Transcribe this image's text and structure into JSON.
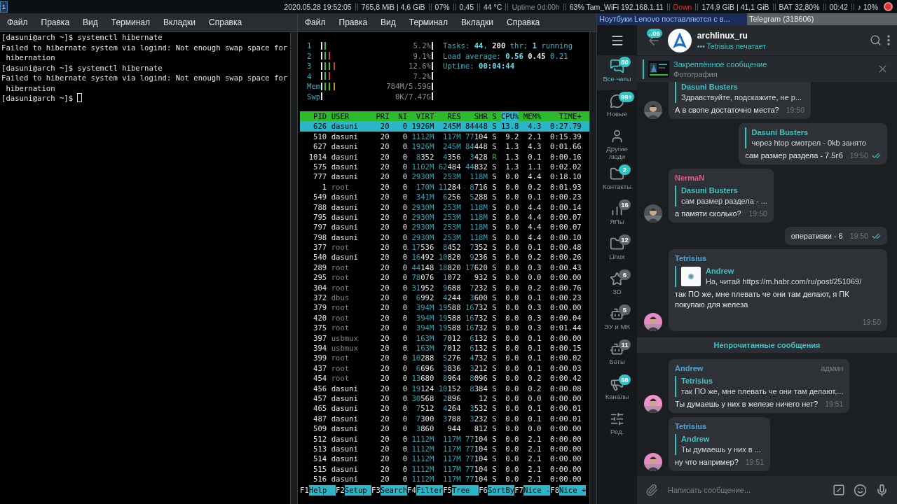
{
  "top_bar": {
    "workspace": "1",
    "segments": [
      {
        "text": "2020.05.28 19:52:05",
        "kind": "normal"
      },
      {
        "text": "765,8 MiB | 4,6 GiB",
        "kind": "normal"
      },
      {
        "text": "07%",
        "kind": "normal"
      },
      {
        "text": "0,45",
        "kind": "normal"
      },
      {
        "text": "44 °C",
        "kind": "normal"
      },
      {
        "text": "Uptime 0d:00h",
        "kind": "dim"
      },
      {
        "text": "63% Tam_WiFi 192.168.1.11",
        "kind": "normal"
      },
      {
        "text": "Down",
        "kind": "alert"
      },
      {
        "text": "174,9 GiB | 41,1 GiB",
        "kind": "normal"
      },
      {
        "text": "BAT 32,80%",
        "kind": "normal"
      },
      {
        "text": "00:42",
        "kind": "normal"
      },
      {
        "text": "♪ 10%",
        "kind": "normal"
      }
    ]
  },
  "terminal": {
    "menu": [
      "Файл",
      "Правка",
      "Вид",
      "Терминал",
      "Вкладки",
      "Справка"
    ],
    "lines": [
      "[dasuni@arch ~]$ systemctl hibernate",
      "Failed to hibernate system via logind: Not enough swap space for",
      " hibernation",
      "[dasuni@arch ~]$ systemctl hibernate",
      "Failed to hibernate system via logind: Not enough swap space for",
      " hibernation"
    ],
    "prompt": "[dasuni@arch ~]$"
  },
  "htop": {
    "menu": [
      "Файл",
      "Правка",
      "Вид",
      "Терминал",
      "Вкладки",
      "Справка"
    ],
    "meters": [
      {
        "kind": "cpu",
        "label": "1",
        "level": 0.052,
        "reading": "5.2%"
      },
      {
        "kind": "cpu",
        "label": "2",
        "level": 0.091,
        "reading": "9.1%"
      },
      {
        "kind": "cpu",
        "label": "3",
        "level": 0.126,
        "reading": "12.6%"
      },
      {
        "kind": "cpu",
        "label": "4",
        "level": 0.072,
        "reading": "7.2%"
      },
      {
        "kind": "mem",
        "label": "Mem",
        "level": 0.14,
        "reading": "784M/5.59G"
      },
      {
        "kind": "swap",
        "label": "Swp",
        "level": 0,
        "reading": "0K/7.47G"
      }
    ],
    "info": [
      "Tasks: **44**, **200** thr; **1** running",
      "Load average: **0.56** **0.45** 0.21",
      "Uptime: **00:04:44**"
    ],
    "columns": [
      {
        "label": "PID",
        "sorted": false
      },
      {
        "label": "USER",
        "sorted": false
      },
      {
        "label": "PRI",
        "sorted": false
      },
      {
        "label": "NI",
        "sorted": false
      },
      {
        "label": "VIRT",
        "sorted": false
      },
      {
        "label": "RES",
        "sorted": false
      },
      {
        "label": "SHR",
        "sorted": false
      },
      {
        "label": "S",
        "sorted": false
      },
      {
        "label": "CPU%",
        "sorted": true
      },
      {
        "label": "MEM%",
        "sorted": false
      },
      {
        "label": "TIME+",
        "sorted": false
      }
    ],
    "rows": [
      {
        "cells": [
          "626",
          "dasuni",
          "20",
          "0",
          "1926M",
          "245M",
          "84448",
          "S",
          "13.8",
          "4.3",
          "0:27.79"
        ],
        "own": true,
        "running": false,
        "selected": true
      },
      {
        "cells": [
          "510",
          "dasuni",
          "20",
          "0",
          "1112M",
          "117M",
          "77104",
          "S",
          "9.2",
          "2.1",
          "0:15.39"
        ],
        "own": true,
        "running": false,
        "selected": false
      },
      {
        "cells": [
          "627",
          "dasuni",
          "20",
          "0",
          "1926M",
          "245M",
          "84448",
          "S",
          "1.3",
          "4.3",
          "0:01.66"
        ],
        "own": true,
        "running": false,
        "selected": false
      },
      {
        "cells": [
          "1014",
          "dasuni",
          "20",
          "0",
          "8352",
          "4356",
          "3428",
          "R",
          "1.3",
          "0.1",
          "0:00.16"
        ],
        "own": true,
        "running": true,
        "selected": false
      },
      {
        "cells": [
          "575",
          "dasuni",
          "20",
          "0",
          "1102M",
          "62484",
          "44832",
          "S",
          "1.3",
          "1.1",
          "0:02.02"
        ],
        "own": true,
        "running": false,
        "selected": false
      },
      {
        "cells": [
          "777",
          "dasuni",
          "20",
          "0",
          "2930M",
          "253M",
          "118M",
          "S",
          "0.0",
          "4.4",
          "0:18.10"
        ],
        "own": true,
        "running": false,
        "selected": false
      },
      {
        "cells": [
          "1",
          "root",
          "20",
          "0",
          "170M",
          "11284",
          "8716",
          "S",
          "0.0",
          "0.2",
          "0:01.93"
        ],
        "own": false,
        "running": false,
        "selected": false
      },
      {
        "cells": [
          "549",
          "dasuni",
          "20",
          "0",
          "341M",
          "6256",
          "5288",
          "S",
          "0.0",
          "0.1",
          "0:00.23"
        ],
        "own": true,
        "running": false,
        "selected": false
      },
      {
        "cells": [
          "788",
          "dasuni",
          "20",
          "0",
          "2930M",
          "253M",
          "118M",
          "S",
          "0.0",
          "4.4",
          "0:00.14"
        ],
        "own": true,
        "running": false,
        "selected": false
      },
      {
        "cells": [
          "795",
          "dasuni",
          "20",
          "0",
          "2930M",
          "253M",
          "118M",
          "S",
          "0.0",
          "4.4",
          "0:00.07"
        ],
        "own": true,
        "running": false,
        "selected": false
      },
      {
        "cells": [
          "797",
          "dasuni",
          "20",
          "0",
          "2930M",
          "253M",
          "118M",
          "S",
          "0.0",
          "4.4",
          "0:00.07"
        ],
        "own": true,
        "running": false,
        "selected": false
      },
      {
        "cells": [
          "798",
          "dasuni",
          "20",
          "0",
          "2930M",
          "253M",
          "118M",
          "S",
          "0.0",
          "4.4",
          "0:00.10"
        ],
        "own": true,
        "running": false,
        "selected": false
      },
      {
        "cells": [
          "377",
          "root",
          "20",
          "0",
          "17536",
          "8452",
          "7352",
          "S",
          "0.0",
          "0.1",
          "0:00.48"
        ],
        "own": false,
        "running": false,
        "selected": false
      },
      {
        "cells": [
          "540",
          "dasuni",
          "20",
          "0",
          "16492",
          "10820",
          "9236",
          "S",
          "0.0",
          "0.2",
          "0:00.26"
        ],
        "own": true,
        "running": false,
        "selected": false
      },
      {
        "cells": [
          "289",
          "root",
          "20",
          "0",
          "44148",
          "18820",
          "17620",
          "S",
          "0.0",
          "0.3",
          "0:00.43"
        ],
        "own": false,
        "running": false,
        "selected": false
      },
      {
        "cells": [
          "295",
          "root",
          "20",
          "0",
          "78076",
          "1072",
          "932",
          "S",
          "0.0",
          "0.0",
          "0:00.00"
        ],
        "own": false,
        "running": false,
        "selected": false
      },
      {
        "cells": [
          "304",
          "root",
          "20",
          "0",
          "31952",
          "9688",
          "7232",
          "S",
          "0.0",
          "0.2",
          "0:00.76"
        ],
        "own": false,
        "running": false,
        "selected": false
      },
      {
        "cells": [
          "372",
          "dbus",
          "20",
          "0",
          "6992",
          "4244",
          "3600",
          "S",
          "0.0",
          "0.1",
          "0:00.23"
        ],
        "own": false,
        "running": false,
        "selected": false
      },
      {
        "cells": [
          "379",
          "root",
          "20",
          "0",
          "394M",
          "19588",
          "16732",
          "S",
          "0.0",
          "0.3",
          "0:00.00"
        ],
        "own": false,
        "running": false,
        "selected": false
      },
      {
        "cells": [
          "420",
          "root",
          "20",
          "0",
          "394M",
          "19588",
          "16732",
          "S",
          "0.0",
          "0.3",
          "0:00.04"
        ],
        "own": false,
        "running": false,
        "selected": false
      },
      {
        "cells": [
          "375",
          "root",
          "20",
          "0",
          "394M",
          "19588",
          "16732",
          "S",
          "0.0",
          "0.3",
          "0:01.44"
        ],
        "own": false,
        "running": false,
        "selected": false
      },
      {
        "cells": [
          "397",
          "usbmux",
          "20",
          "0",
          "163M",
          "7012",
          "6132",
          "S",
          "0.0",
          "0.1",
          "0:00.00"
        ],
        "own": false,
        "running": false,
        "selected": false
      },
      {
        "cells": [
          "394",
          "usbmux",
          "20",
          "0",
          "163M",
          "7012",
          "6132",
          "S",
          "0.0",
          "0.1",
          "0:00.15"
        ],
        "own": false,
        "running": false,
        "selected": false
      },
      {
        "cells": [
          "399",
          "root",
          "20",
          "0",
          "10288",
          "5276",
          "4732",
          "S",
          "0.0",
          "0.1",
          "0:00.02"
        ],
        "own": false,
        "running": false,
        "selected": false
      },
      {
        "cells": [
          "437",
          "root",
          "20",
          "0",
          "6696",
          "3836",
          "3212",
          "S",
          "0.0",
          "0.1",
          "0:00.03"
        ],
        "own": false,
        "running": false,
        "selected": false
      },
      {
        "cells": [
          "454",
          "root",
          "20",
          "0",
          "13680",
          "8964",
          "8096",
          "S",
          "0.0",
          "0.2",
          "0:00.42"
        ],
        "own": false,
        "running": false,
        "selected": false
      },
      {
        "cells": [
          "456",
          "dasuni",
          "20",
          "0",
          "19124",
          "10152",
          "8384",
          "S",
          "0.0",
          "0.2",
          "0:00.08"
        ],
        "own": true,
        "running": false,
        "selected": false
      },
      {
        "cells": [
          "457",
          "dasuni",
          "20",
          "0",
          "30568",
          "2896",
          "12",
          "S",
          "0.0",
          "0.0",
          "0:00.00"
        ],
        "own": true,
        "running": false,
        "selected": false
      },
      {
        "cells": [
          "465",
          "dasuni",
          "20",
          "0",
          "7512",
          "4264",
          "3532",
          "S",
          "0.0",
          "0.1",
          "0:00.01"
        ],
        "own": true,
        "running": false,
        "selected": false
      },
      {
        "cells": [
          "487",
          "dasuni",
          "20",
          "0",
          "7300",
          "3788",
          "3232",
          "S",
          "0.0",
          "0.1",
          "0:00.01"
        ],
        "own": true,
        "running": false,
        "selected": false
      },
      {
        "cells": [
          "509",
          "dasuni",
          "20",
          "0",
          "3860",
          "944",
          "812",
          "S",
          "0.0",
          "0.0",
          "0:00.00"
        ],
        "own": true,
        "running": false,
        "selected": false
      },
      {
        "cells": [
          "512",
          "dasuni",
          "20",
          "0",
          "1112M",
          "117M",
          "77104",
          "S",
          "0.0",
          "2.1",
          "0:00.00"
        ],
        "own": true,
        "running": false,
        "selected": false
      },
      {
        "cells": [
          "513",
          "dasuni",
          "20",
          "0",
          "1112M",
          "117M",
          "77104",
          "S",
          "0.0",
          "2.1",
          "0:00.00"
        ],
        "own": true,
        "running": false,
        "selected": false
      },
      {
        "cells": [
          "514",
          "dasuni",
          "20",
          "0",
          "1112M",
          "117M",
          "77104",
          "S",
          "0.0",
          "2.1",
          "0:00.00"
        ],
        "own": true,
        "running": false,
        "selected": false
      },
      {
        "cells": [
          "515",
          "dasuni",
          "20",
          "0",
          "1112M",
          "117M",
          "77104",
          "S",
          "0.0",
          "2.1",
          "0:00.00"
        ],
        "own": true,
        "running": false,
        "selected": false
      },
      {
        "cells": [
          "516",
          "dasuni",
          "20",
          "0",
          "1112M",
          "117M",
          "77104",
          "S",
          "0.0",
          "2.1",
          "0:00.00"
        ],
        "own": true,
        "running": false,
        "selected": false
      }
    ],
    "function_keys": [
      {
        "key": "F1",
        "label": "Help"
      },
      {
        "key": "F2",
        "label": "Setup"
      },
      {
        "key": "F3",
        "label": "Search"
      },
      {
        "key": "F4",
        "label": "Filter"
      },
      {
        "key": "F5",
        "label": "Tree"
      },
      {
        "key": "F6",
        "label": "SortBy"
      },
      {
        "key": "F7",
        "label": "Nice -"
      },
      {
        "key": "F8",
        "label": "Nice +"
      }
    ]
  },
  "window_tabs": [
    {
      "title": "Ноутбуки Lenovo поставляются с в...",
      "selected": false
    },
    {
      "title": "Telegram (318606)",
      "selected": true
    }
  ],
  "telegram": {
    "folders": [
      {
        "label": "Все чаты",
        "badge": "80",
        "muted": false,
        "selected": true
      },
      {
        "label": "Новые",
        "badge": "99+",
        "muted": false,
        "selected": false
      },
      {
        "label": "Другие люди",
        "selected": false
      },
      {
        "label": "Контакты",
        "badge": "2",
        "muted": false,
        "selected": false
      },
      {
        "label": "ЯПы",
        "badge": "16",
        "muted": true,
        "selected": false
      },
      {
        "label": "Linux",
        "badge": "12",
        "muted": true,
        "selected": false
      },
      {
        "label": "3D",
        "badge": "6",
        "muted": true,
        "selected": false
      },
      {
        "label": "ЭУ и МК",
        "badge": "5",
        "muted": true,
        "selected": false
      },
      {
        "label": "Боты",
        "badge": "11",
        "muted": true,
        "selected": false
      },
      {
        "label": "Каналы",
        "badge": "56",
        "muted": false,
        "selected": false
      },
      {
        "label": "Ред.",
        "selected": false
      }
    ],
    "header": {
      "unread_badge": "..06",
      "title": "archlinux_ru",
      "status": "••• Tetrisius печатает"
    },
    "pinned": {
      "title": "Закреплённое сообщение",
      "text": "Фотография"
    },
    "messages": [
      {
        "outgoing": false,
        "reply": {
          "name": "Dasuni Busters",
          "text": "Здравствуйте, подскажите, не р...",
          "thumbnail": false
        },
        "text": "А в свопе достаточно места?",
        "time": "19:50"
      },
      {
        "outgoing": true,
        "reply": {
          "name": "Dasuni Busters",
          "text": "через htop смотрел - 0kb занято",
          "thumbnail": false
        },
        "text": "сам размер раздела - 7.5гб",
        "time": "19:50",
        "read": true
      },
      {
        "outgoing": false,
        "sender": "NermaN",
        "color": "#d75f86",
        "reply": {
          "name": "Dasuni Busters",
          "text": "сам размер раздела - ...",
          "thumbnail": false
        },
        "text": "а памяти сколько?",
        "time": "19:50"
      },
      {
        "outgoing": true,
        "text": "оперативки - 6",
        "time": "19:50",
        "read": true
      },
      {
        "outgoing": false,
        "sender": "Tetrisius",
        "color": "#4ea7d8",
        "reply": {
          "name": "Andrew",
          "text": "На, читай https://m.habr.com/ru/post/251069/",
          "thumbnail": true
        },
        "text": "так ПО же, мне плевать че они там делают, я ПК покупаю для железа",
        "time": "19:50"
      },
      {
        "kind": "separator",
        "text": "Непрочитанные сообщения"
      },
      {
        "outgoing": false,
        "sender": "Andrew",
        "color": "#4ea7d8",
        "role": "админ",
        "reply": {
          "name": "Tetrisius",
          "text": "так ПО же, мне плевать че они там делают,...",
          "thumbnail": false
        },
        "text": "Ты думаешь у них в железе ничего нет?",
        "time": "19:51"
      },
      {
        "outgoing": false,
        "sender": "Tetrisius",
        "color": "#4ea7d8",
        "reply": {
          "name": "Andrew",
          "text": "Ты думаешь у них в ...",
          "thumbnail": false
        },
        "text": "ну что например?",
        "time": "19:51"
      }
    ],
    "composer": {
      "placeholder": "Написать сообщение..."
    }
  }
}
